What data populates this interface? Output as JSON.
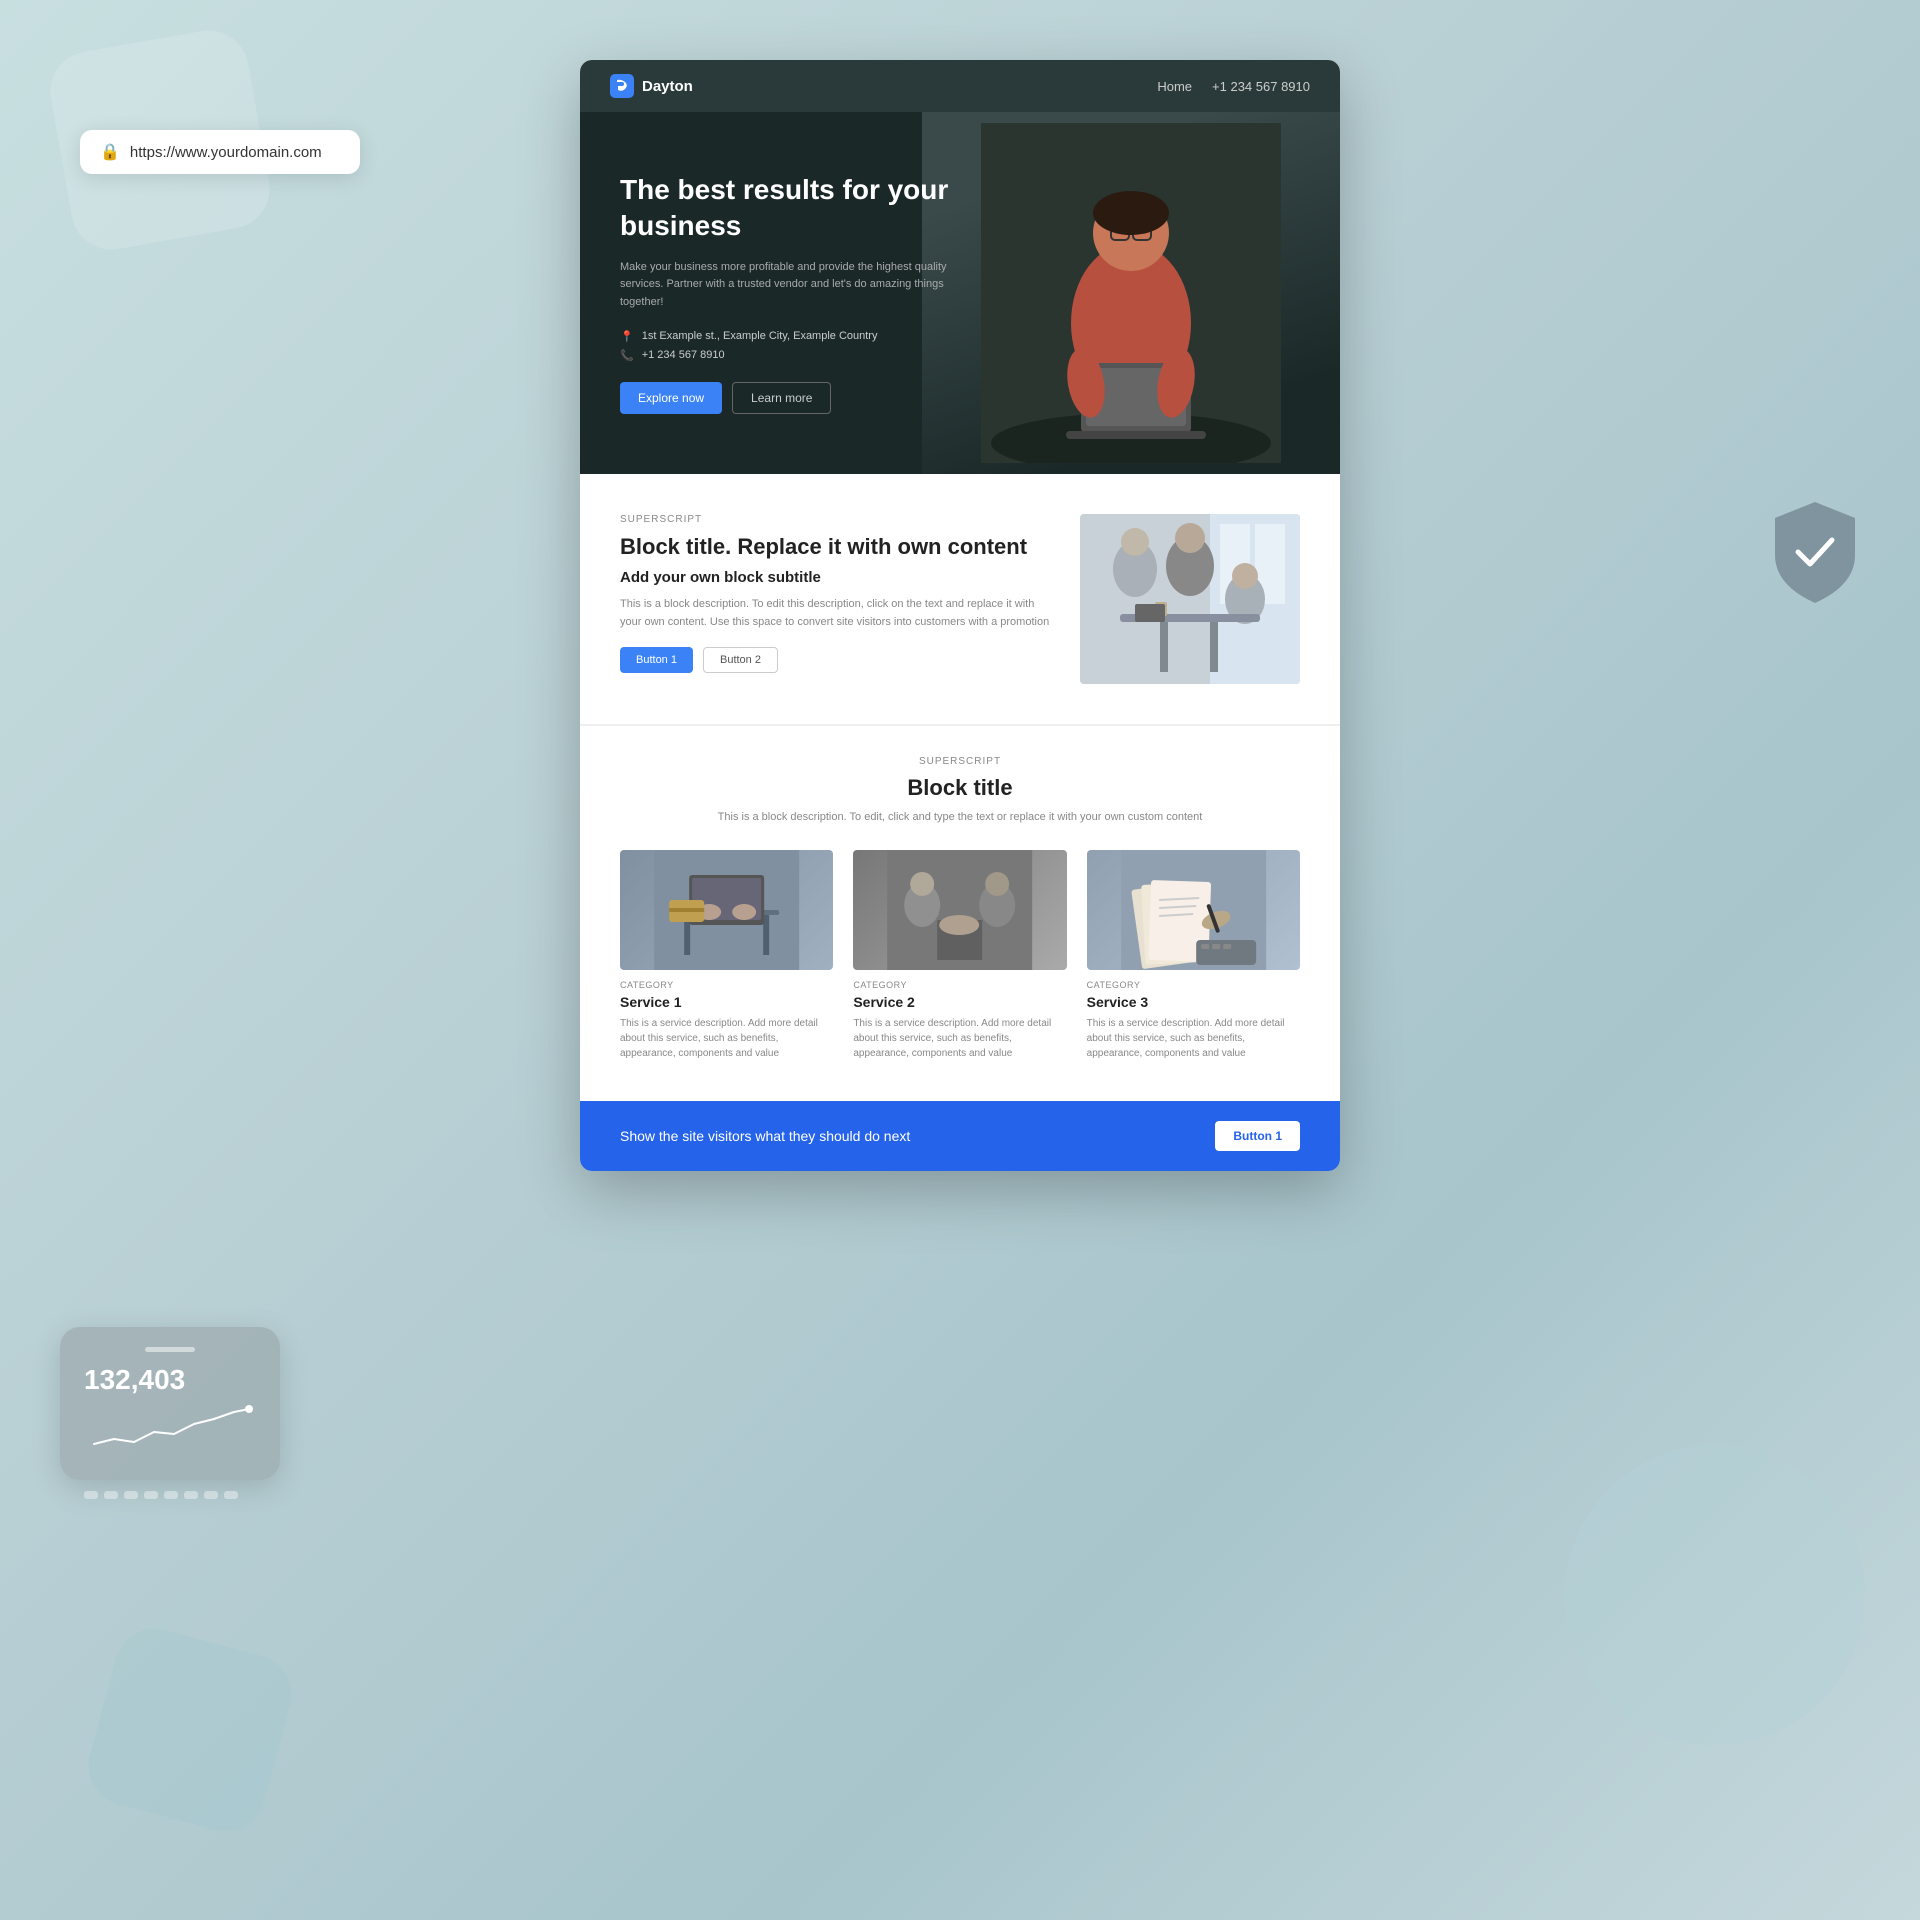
{
  "page": {
    "background": "#c5d8dc",
    "url": "https://www.yourdomain.com"
  },
  "urlbar": {
    "url": "https://www.yourdomain.com",
    "lock_label": "🔒"
  },
  "stats_widget": {
    "number": "132,403"
  },
  "nav": {
    "logo_text": "Dayton",
    "logo_icon": "D",
    "links": [
      "Home",
      "+1 234 567 8910"
    ]
  },
  "hero": {
    "title": "The best results for your business",
    "subtitle": "Make your business more profitable and provide the highest quality services. Partner with a trusted vendor and let's do amazing things together!",
    "address": "1st Example st., Example City, Example Country",
    "phone": "+1 234 567 8910",
    "btn_explore": "Explore now",
    "btn_learn": "Learn more"
  },
  "block_section": {
    "superscript": "SUPERSCRIPT",
    "title": "Block title. Replace it with own content",
    "subtitle": "Add your own block subtitle",
    "description": "This is a block description. To edit this description, click on the text and replace it with your own content. Use this space to convert site visitors into customers with a promotion",
    "btn1": "Button 1",
    "btn2": "Button 2"
  },
  "services_section": {
    "superscript": "SUPERSCRIPT",
    "title": "Block title",
    "description": "This is a block description. To edit, click and type the text or replace it with your own custom content",
    "services": [
      {
        "category": "Category",
        "name": "Service 1",
        "description": "This is a service description. Add more detail about this service, such as benefits, appearance, components and value"
      },
      {
        "category": "Category",
        "name": "Service 2",
        "description": "This is a service description. Add more detail about this service, such as benefits, appearance, components and value"
      },
      {
        "category": "Category",
        "name": "Service 3",
        "description": "This is a service description. Add more detail about this service, such as benefits, appearance, components and value"
      }
    ]
  },
  "cta_bar": {
    "text": "Show the site visitors what they should do next",
    "button": "Button 1"
  }
}
